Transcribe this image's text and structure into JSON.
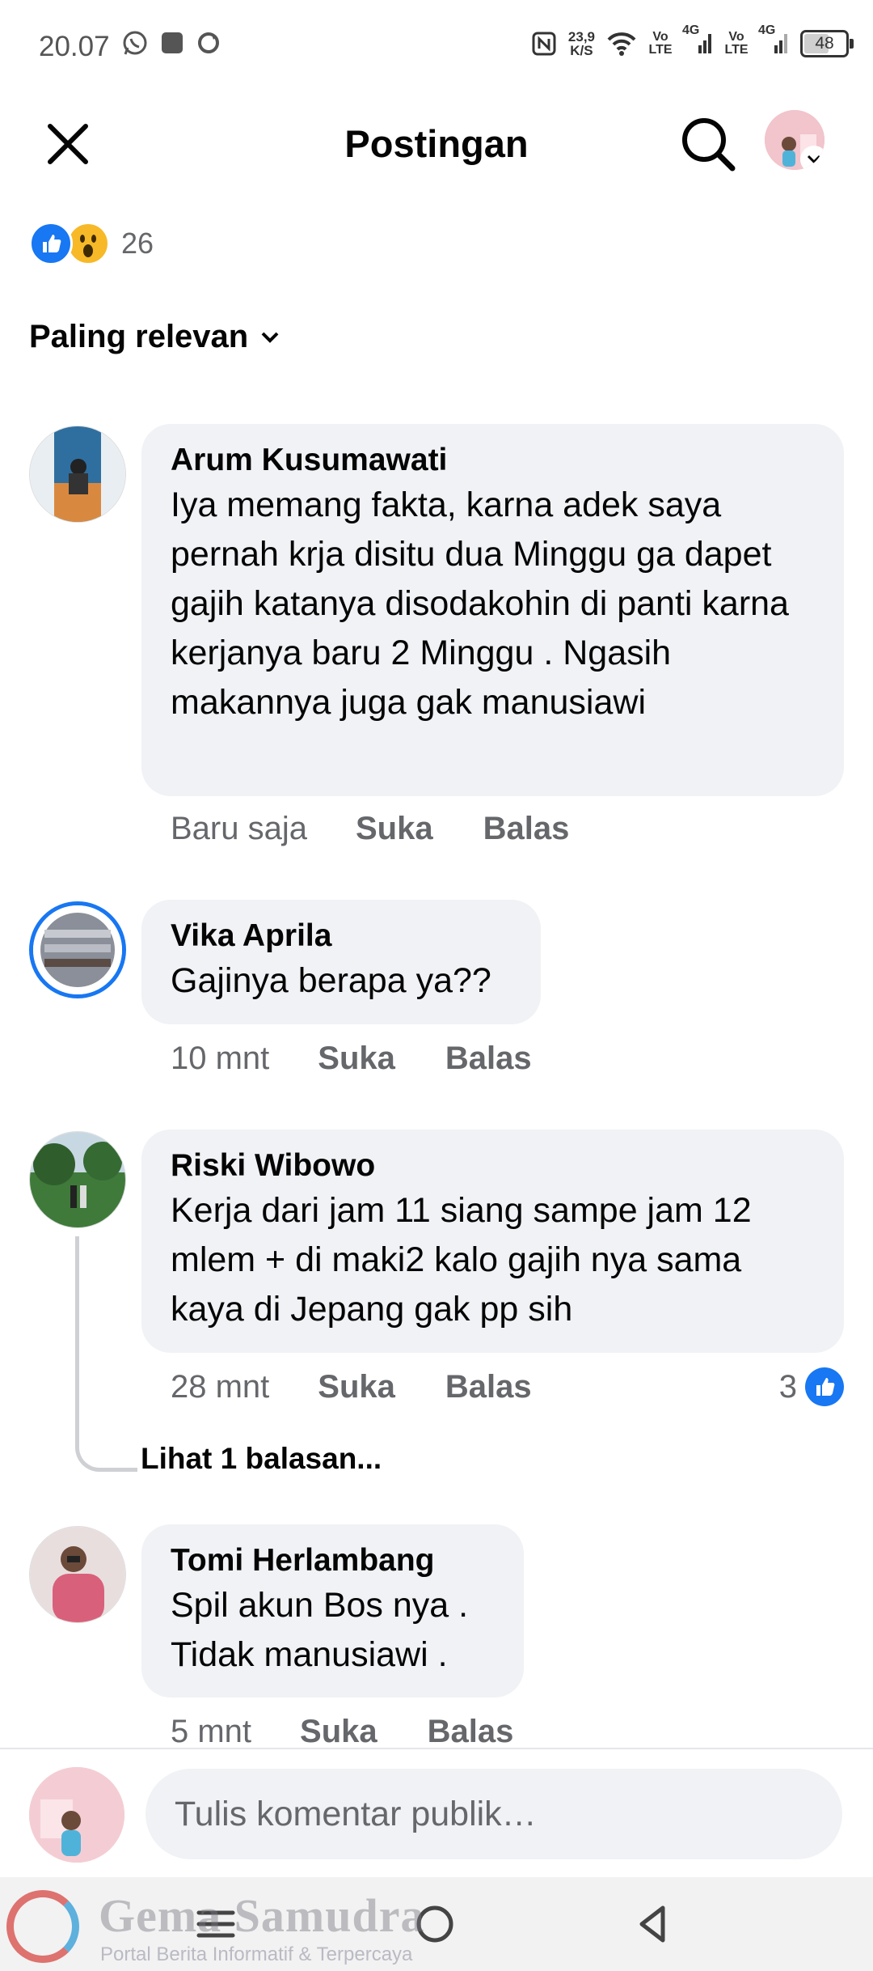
{
  "status_bar": {
    "time": "20.07",
    "net_speed_value": "23,9",
    "net_speed_unit": "K/S",
    "volte_1": "Vo LTE",
    "signal_1": "4G",
    "volte_2": "Vo LTE",
    "signal_2": "4G",
    "battery": "48"
  },
  "header": {
    "title": "Postingan"
  },
  "reactions": {
    "count": "26"
  },
  "sort": {
    "label": "Paling relevan"
  },
  "comments": [
    {
      "author": "Arum Kusumawati",
      "text": "Iya memang fakta, karna adek saya pernah krja disitu dua Minggu ga dapet gajih katanya disodakohin di panti karna kerjanya baru 2 Minggu . Ngasih makannya juga gak manusiawi",
      "time": "Baru saja",
      "like": "Suka",
      "reply": "Balas"
    },
    {
      "author": "Vika Aprila",
      "text": "Gajinya berapa ya??",
      "time": "10 mnt",
      "like": "Suka",
      "reply": "Balas"
    },
    {
      "author": "Riski Wibowo",
      "text": "Kerja dari jam 11 siang sampe jam 12 mlem + di maki2 kalo gajih nya sama kaya di Jepang gak pp sih",
      "time": "28 mnt",
      "like": "Suka",
      "reply": "Balas",
      "likes": "3",
      "view_replies": "Lihat 1 balasan..."
    },
    {
      "author": "Tomi Herlambang",
      "text": "Spil akun Bos nya . Tidak manusiawi .",
      "time": "5 mnt",
      "like": "Suka",
      "reply": "Balas"
    }
  ],
  "composer": {
    "placeholder": "Tulis komentar publik…"
  },
  "watermark": {
    "title": "Gema Samudra",
    "subtitle": "Portal Berita Informatif & Terpercaya"
  },
  "colors": {
    "accent": "#1877f2",
    "bubble": "#f0f2f5",
    "secondary_text": "#65676b"
  }
}
